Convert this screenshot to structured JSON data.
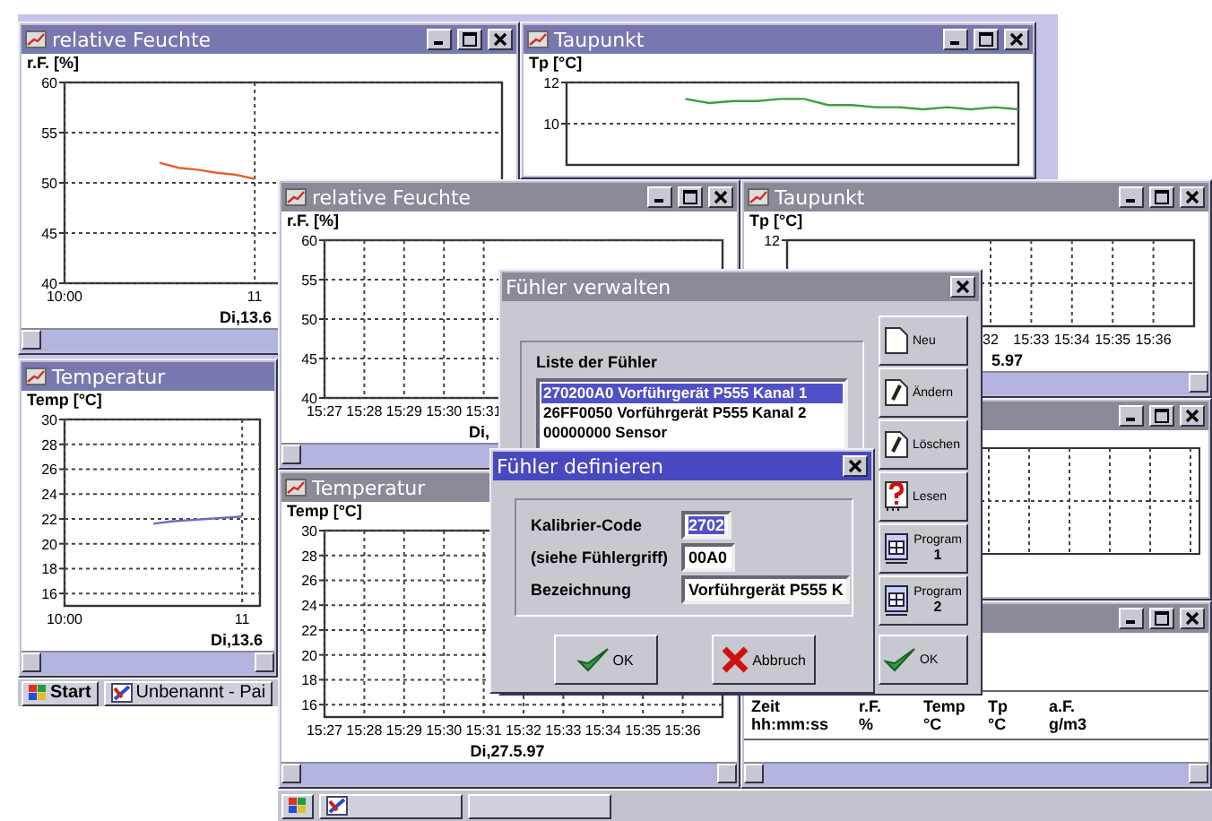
{
  "back_screen": {
    "windows": [
      {
        "kind": "chart",
        "title": "relative Feuchte",
        "chart_data": {
          "type": "line",
          "grid": true,
          "ylabel": "r.F. [%]",
          "xlabel": "Di,13.6",
          "ylim": [
            40,
            60
          ],
          "yticks": [
            40,
            45,
            50,
            55,
            60
          ],
          "categories": [
            "10:00",
            null,
            null,
            null,
            null,
            null,
            null,
            null,
            null,
            null,
            "11",
            null,
            null,
            null,
            null,
            null,
            null,
            null,
            null,
            null,
            null,
            null,
            null,
            null
          ],
          "series": [
            {
              "color": "#e8602a",
              "values": [
                null,
                null,
                null,
                null,
                null,
                52,
                51.5,
                51.3,
                51,
                50.8,
                50.4,
                null,
                null,
                null,
                null,
                null,
                null,
                null,
                null,
                null,
                null,
                null,
                null,
                null
              ]
            }
          ]
        }
      },
      {
        "kind": "chart",
        "title": "Taupunkt",
        "chart_data": {
          "type": "line",
          "grid": true,
          "ylabel": "Tp [°C]",
          "ylim": [
            8,
            12
          ],
          "yticks": [
            10,
            12
          ],
          "categories": [
            null,
            null,
            null,
            null,
            null,
            null,
            null,
            null,
            null,
            null,
            null,
            null,
            null,
            null,
            null,
            null,
            null,
            null,
            null,
            null
          ],
          "series": [
            {
              "color": "#3aa040",
              "values": [
                null,
                null,
                null,
                null,
                null,
                11.2,
                11.0,
                11.1,
                11.1,
                11.2,
                11.2,
                10.9,
                10.9,
                10.8,
                10.8,
                10.7,
                10.8,
                10.7,
                10.8,
                10.7
              ]
            }
          ]
        }
      },
      {
        "kind": "chart",
        "title": "Temperatur",
        "chart_data": {
          "type": "line",
          "grid": true,
          "ylabel": "Temp [°C]",
          "xlabel": "Di,13.6",
          "ylim": [
            15,
            30
          ],
          "yticks": [
            16,
            18,
            20,
            22,
            24,
            26,
            28,
            30
          ],
          "categories": [
            "10:00",
            null,
            null,
            null,
            null,
            null,
            null,
            null,
            null,
            null,
            "11",
            null
          ],
          "series": [
            {
              "color": "#6a6ad0",
              "values": [
                null,
                null,
                null,
                null,
                null,
                21.6,
                21.8,
                21.9,
                22.0,
                22.1,
                22.2,
                null
              ]
            }
          ]
        }
      }
    ],
    "taskbar": {
      "buttons": [
        {
          "kind": "start",
          "label": "Start"
        },
        {
          "kind": "app",
          "label": "Unbenannt - Pai"
        }
      ]
    }
  },
  "front_screen": {
    "windows": [
      {
        "kind": "chart",
        "title": "relative Feuchte",
        "chart_data": {
          "type": "line",
          "grid": true,
          "ylabel": "r.F. [%]",
          "xlabel": "Di,",
          "ylim": [
            40,
            60
          ],
          "yticks": [
            40,
            45,
            50,
            55,
            60
          ],
          "categories": [
            "15:27",
            "15:28",
            "15:29",
            "15:30",
            "15:31",
            null,
            null,
            null,
            null,
            null,
            null
          ]
        }
      },
      {
        "kind": "chart",
        "title": "Taupunkt",
        "axes": {
          "ylabel": "Tp [°C]",
          "y_label": "12",
          "x_labels": [
            "32",
            "15:33",
            "15:34",
            "15:35",
            "15:36"
          ],
          "xlabel": "5.97",
          "grid": true
        }
      },
      {
        "kind": "grid"
      },
      {
        "kind": "chart",
        "title": "Temperatur",
        "chart_data": {
          "type": "line",
          "grid": true,
          "ylabel": "Temp [°C]",
          "xlabel": "Di,27.5.97",
          "ylim": [
            15,
            30
          ],
          "yticks": [
            16,
            18,
            20,
            22,
            24,
            26,
            28,
            30
          ],
          "categories": [
            "15:27",
            "15:28",
            "15:29",
            "15:30",
            "15:31",
            "15:32",
            "15:33",
            "15:34",
            "15:35",
            "15:36",
            null
          ]
        }
      },
      {
        "kind": "table",
        "columns": [
          {
            "label": "Zeit",
            "unit": "hh:mm:ss"
          },
          {
            "label": "r.F.",
            "unit": "%"
          },
          {
            "label": "Temp",
            "unit": "°C"
          },
          {
            "label": "Tp",
            "unit": "°C"
          },
          {
            "label": "a.F.",
            "unit": "g/m3"
          }
        ]
      }
    ]
  },
  "dialogs": [
    {
      "kind": "list",
      "title": "Fühler verwalten",
      "active": false,
      "list_label": "Liste der Fühler",
      "items": [
        {
          "label": "270200A0 Vorführgerät P555 Kanal 1",
          "selected": true
        },
        {
          "label": "26FF0050 Vorführgerät P555 Kanal 2",
          "selected": false
        },
        {
          "label": "00000000 Sensor",
          "selected": false
        }
      ],
      "buttons": [
        {
          "kind": "new",
          "label": "Neu"
        },
        {
          "kind": "edit",
          "label": "Ändern"
        },
        {
          "kind": "delete",
          "label": "Löschen"
        },
        {
          "kind": "read",
          "label": "Lesen"
        },
        {
          "kind": "program",
          "label": "Program",
          "sublabel": "1"
        },
        {
          "kind": "program",
          "label": "Program",
          "sublabel": "2"
        },
        {
          "kind": "ok",
          "label": "OK"
        }
      ]
    },
    {
      "kind": "form",
      "title": "Fühler definieren",
      "active": true,
      "fields": [
        {
          "label": "Kalibrier-Code",
          "value": "2702",
          "highlighted": true
        },
        {
          "label": "(siehe Fühlergriff)",
          "value": "00A0",
          "highlighted": false
        },
        {
          "label": "Bezeichnung",
          "value": "Vorführgerät P555 K",
          "highlighted": false
        }
      ],
      "buttons": [
        {
          "kind": "ok",
          "label": "OK"
        },
        {
          "kind": "cancel",
          "label": "Abbruch"
        }
      ]
    }
  ]
}
